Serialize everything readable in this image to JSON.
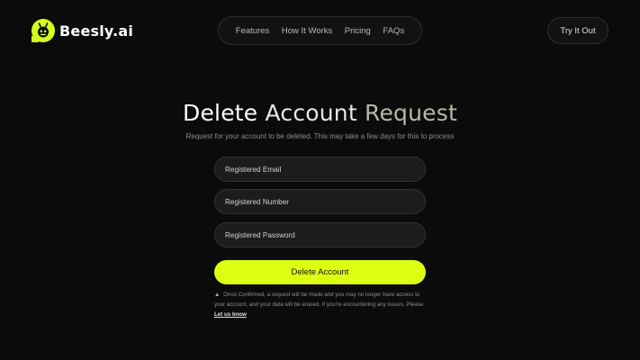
{
  "brand": {
    "name": "Beesly.ai",
    "accent_color": "#d4ff1e"
  },
  "nav": {
    "items": [
      "Features",
      "How It Works",
      "Pricing",
      "FAQs"
    ]
  },
  "header": {
    "cta_label": "Try It Out"
  },
  "main": {
    "title_parts": [
      "Delete",
      "Account",
      "Request"
    ],
    "subtitle": "Request for your account to be deleted. This may take a few days for this to process",
    "fields": {
      "email_placeholder": "Registered Email",
      "number_placeholder": "Registered Number",
      "password_placeholder": "Registered Password"
    },
    "submit_label": "Delete Account",
    "notice": {
      "icon": "warning-icon",
      "text": "Once Confirmed, a request will be made and you may no longer have access to your account, and your data will be erased. If you're encountering any issues, Please",
      "link_label": "Let us know"
    }
  }
}
